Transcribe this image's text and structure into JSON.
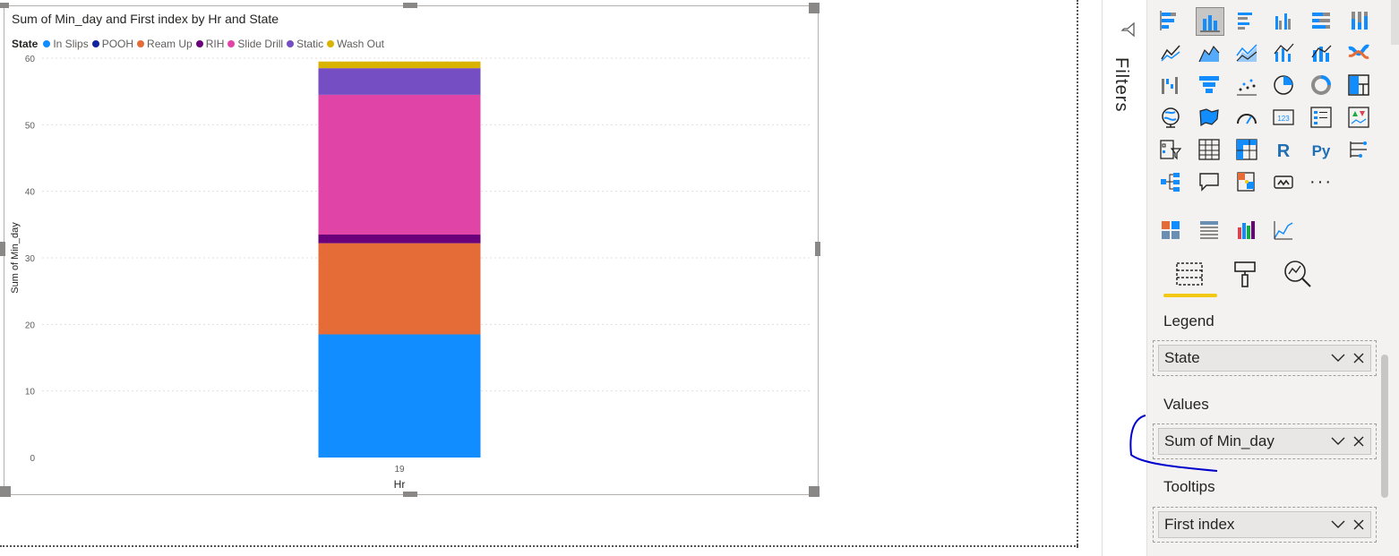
{
  "chart_data": {
    "type": "bar",
    "stacked": true,
    "title": "Sum of Min_day and First index by Hr and State",
    "xlabel": "Hr",
    "ylabel": "Sum of Min_day",
    "categories": [
      "19"
    ],
    "ylim": [
      0,
      60
    ],
    "yticks": [
      0,
      10,
      20,
      30,
      40,
      50,
      60
    ],
    "grid": true,
    "legend_title": "State",
    "legend_position": "top-left",
    "series": [
      {
        "name": "In Slips",
        "color": "#118DFF",
        "values": [
          18.5
        ]
      },
      {
        "name": "POOH",
        "color": "#12239E",
        "values": [
          0
        ]
      },
      {
        "name": "Ream Up",
        "color": "#E66C37",
        "values": [
          13.7
        ]
      },
      {
        "name": "RIH",
        "color": "#6B007B",
        "values": [
          1.3
        ]
      },
      {
        "name": "Slide Drill",
        "color": "#E044A7",
        "values": [
          21.0
        ]
      },
      {
        "name": "Static",
        "color": "#744EC2",
        "values": [
          4.0
        ]
      },
      {
        "name": "Wash Out",
        "color": "#D9B300",
        "values": [
          1.0
        ]
      }
    ]
  },
  "filters_pane": {
    "label": "Filters",
    "icon": "filter-icon"
  },
  "visualizations_pane": {
    "icons": [
      "stacked-bar-icon",
      "stacked-column-icon",
      "clustered-bar-icon",
      "clustered-column-icon",
      "100-stacked-bar-icon",
      "100-stacked-column-icon",
      "line-chart-icon",
      "area-chart-icon",
      "stacked-area-icon",
      "line-clustered-column-icon",
      "line-stacked-column-icon",
      "ribbon-chart-icon",
      "waterfall-icon",
      "funnel-icon",
      "scatter-icon",
      "pie-icon",
      "donut-icon",
      "treemap-icon",
      "map-icon",
      "filled-map-icon",
      "gauge-icon",
      "card-icon",
      "multi-row-card-icon",
      "kpi-icon",
      "slicer-icon",
      "table-icon",
      "matrix-icon",
      "r-visual-icon",
      "python-visual-icon",
      "key-influencers-icon",
      "decomposition-tree-icon",
      "qa-icon",
      "smart-narrative-icon",
      "paginated-report-icon",
      "more-icon"
    ],
    "text_icons": {
      "r": "R",
      "py": "Py",
      "card": "123",
      "more": "···"
    },
    "extra_icons": [
      "custom-visual-1-icon",
      "custom-visual-2-icon",
      "custom-visual-3-icon",
      "custom-visual-4-icon"
    ],
    "tabs": [
      "fields-tab-icon",
      "format-tab-icon",
      "analytics-tab-icon"
    ],
    "accent_color": "#F2C811"
  },
  "wells": {
    "legend": {
      "label": "Legend",
      "field": "State"
    },
    "values": {
      "label": "Values",
      "field": "Sum of Min_day"
    },
    "tooltips": {
      "label": "Tooltips",
      "field": "First index"
    }
  },
  "annotation_color": "#0000CC"
}
